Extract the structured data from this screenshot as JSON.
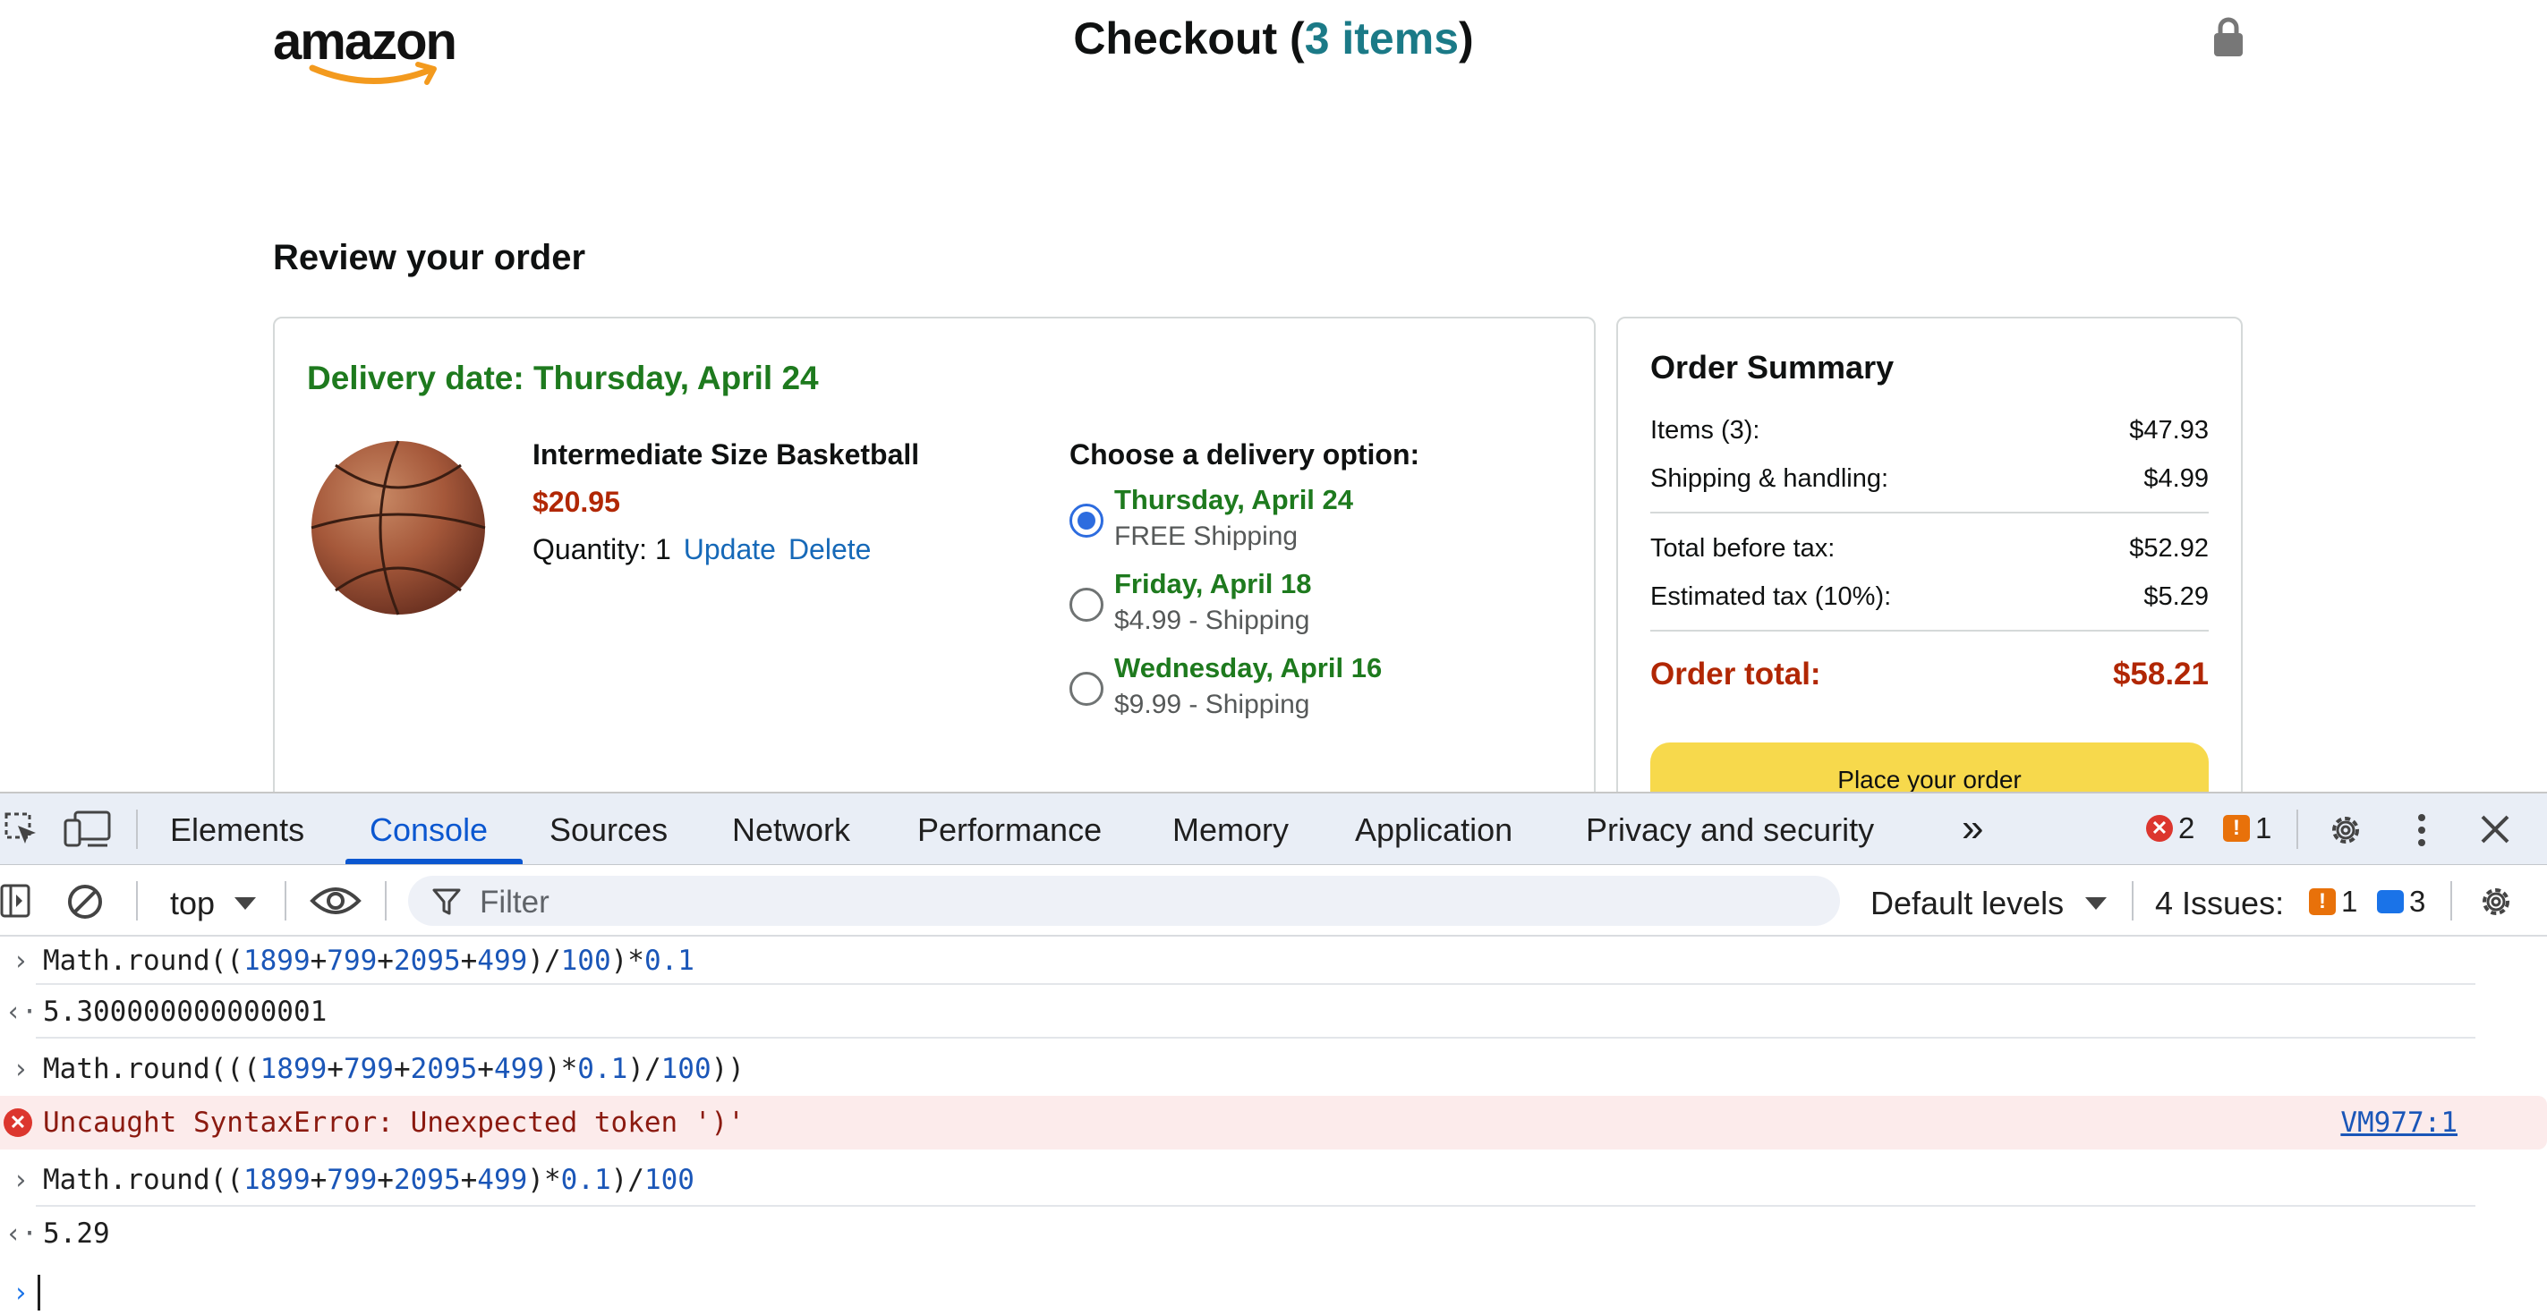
{
  "page": {
    "logo_text": "amazon",
    "checkout_label": "Checkout (",
    "checkout_count": "3 items",
    "checkout_close": ")",
    "review_title": "Review your order",
    "delivery_date": "Delivery date: Thursday, April 24",
    "item": {
      "name": "Intermediate Size Basketball",
      "price": "$20.95",
      "quantity": "Quantity: 1",
      "update": "Update",
      "delete": "Delete"
    },
    "delivery": {
      "title": "Choose a delivery option:",
      "options": [
        {
          "date": "Thursday, April 24",
          "shipping": "FREE Shipping",
          "selected": true
        },
        {
          "date": "Friday, April 18",
          "shipping": "$4.99 - Shipping",
          "selected": false
        },
        {
          "date": "Wednesday, April 16",
          "shipping": "$9.99 - Shipping",
          "selected": false
        }
      ]
    },
    "summary": {
      "title": "Order Summary",
      "rows": [
        {
          "label": "Items (3):",
          "value": "$47.93"
        },
        {
          "label": "Shipping & handling:",
          "value": "$4.99"
        }
      ],
      "rows2": [
        {
          "label": "Total before tax:",
          "value": "$52.92"
        },
        {
          "label": "Estimated tax (10%):",
          "value": "$5.29"
        }
      ],
      "total_label": "Order total:",
      "total_value": "$58.21",
      "button": "Place your order"
    },
    "colors": {
      "green": "#1e7a1e",
      "price_red": "#b12704",
      "link": "#1669b8",
      "button": "#f7d94c",
      "teal": "#1b7a87"
    }
  },
  "devtools": {
    "tabs": [
      "Elements",
      "Console",
      "Sources",
      "Network",
      "Performance",
      "Memory",
      "Application",
      "Privacy and security"
    ],
    "active_tab": "Console",
    "more_tabs": "»",
    "errors_count": "2",
    "warnings_count": "1",
    "context": "top",
    "filter_placeholder": "Filter",
    "levels": "Default levels",
    "issues_label": "4 Issues:",
    "issues_warn": "1",
    "issues_info": "3",
    "console": [
      {
        "kind": "input",
        "text": "Math.round((1899+799+2095+499)/100)*0.1"
      },
      {
        "kind": "result",
        "text": "5.300000000000001"
      },
      {
        "kind": "input",
        "text": "Math.round(((1899+799+2095+499)*0.1)/100))"
      },
      {
        "kind": "error",
        "text": "Uncaught SyntaxError: Unexpected token ')'",
        "source": "VM977:1"
      },
      {
        "kind": "input",
        "text": "Math.round((1899+799+2095+499)*0.1)/100"
      },
      {
        "kind": "result",
        "text": "5.29"
      }
    ]
  }
}
